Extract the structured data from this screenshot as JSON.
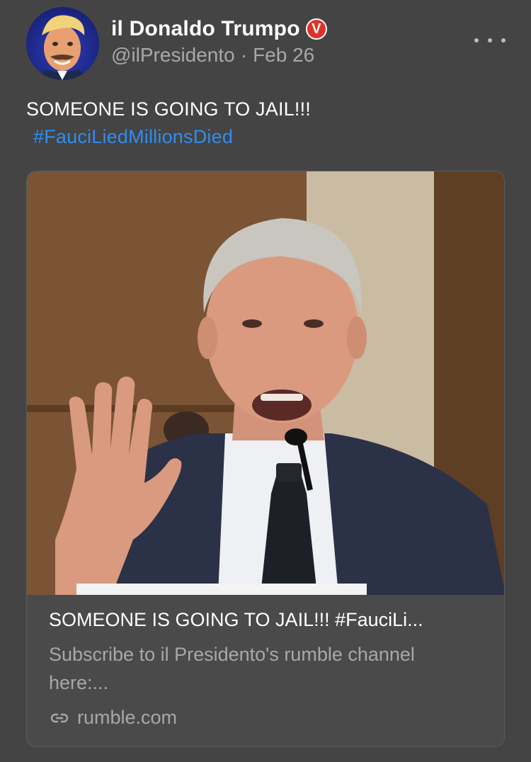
{
  "author": {
    "display_name": "il Donaldo Trumpo",
    "verified_symbol": "V",
    "handle": "@ilPresidento",
    "separator": "·",
    "date": "Feb 26",
    "avatar_icon": "user-avatar"
  },
  "post": {
    "text": "SOMEONE IS GOING TO JAIL!!!",
    "hashtag": "#FauciLiedMillionsDied"
  },
  "link_card": {
    "image_icon": "video-thumbnail",
    "title": "SOMEONE IS GOING TO JAIL!!! #FauciLi...",
    "description": "Subscribe to il Presidento's rumble channel here:...",
    "domain": "rumble.com",
    "domain_icon": "link-icon"
  },
  "colors": {
    "background": "#444444",
    "hashtag": "#2f8df0",
    "verified_badge": "#e0322a",
    "muted_text": "#a8a8a8"
  }
}
